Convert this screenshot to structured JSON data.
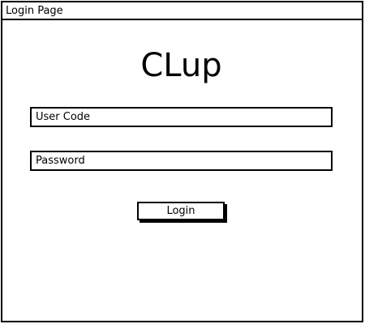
{
  "window": {
    "title": "Login Page"
  },
  "app": {
    "name": "CLup"
  },
  "form": {
    "user_code_placeholder": "User Code",
    "password_placeholder": "Password",
    "login_label": "Login"
  }
}
